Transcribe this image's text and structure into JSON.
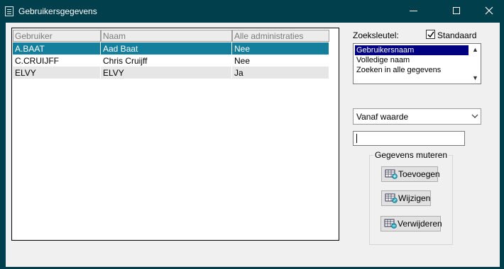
{
  "window": {
    "title": "Gebruikersgegevens",
    "icon": "document-icon",
    "controls": {
      "minimize": "minimize-icon",
      "maximize": "maximize-icon",
      "close": "close-icon"
    }
  },
  "grid": {
    "columns": [
      "Gebruiker",
      "Naam",
      "Alle administraties"
    ],
    "rows": [
      {
        "user": "A.BAAT",
        "name": "Aad Baat",
        "all_admin": "Nee",
        "selected": true
      },
      {
        "user": "C.CRUIJFF",
        "name": "Chris Cruijff",
        "all_admin": "Nee",
        "selected": false
      },
      {
        "user": "ELVY",
        "name": "ELVY",
        "all_admin": "Ja",
        "selected": false
      }
    ]
  },
  "search": {
    "key_label": "Zoeksleutel:",
    "standard_label": "Standaard",
    "standard_checked": true,
    "key_options": [
      "Gebruikersnaam",
      "Volledige naam",
      "Zoeken in alle gegevens"
    ],
    "selected_option": "Gebruikersnaam",
    "mode_value": "Vanaf waarde",
    "search_value": ""
  },
  "mutate": {
    "group_label": "Gegevens muteren",
    "add_label": "Toevoegen",
    "edit_label": "Wijzigen",
    "delete_label": "Verwijderen"
  },
  "colors": {
    "title_bar": "#003f4b",
    "selected_row": "#137f9c",
    "list_selection": "#000080"
  }
}
